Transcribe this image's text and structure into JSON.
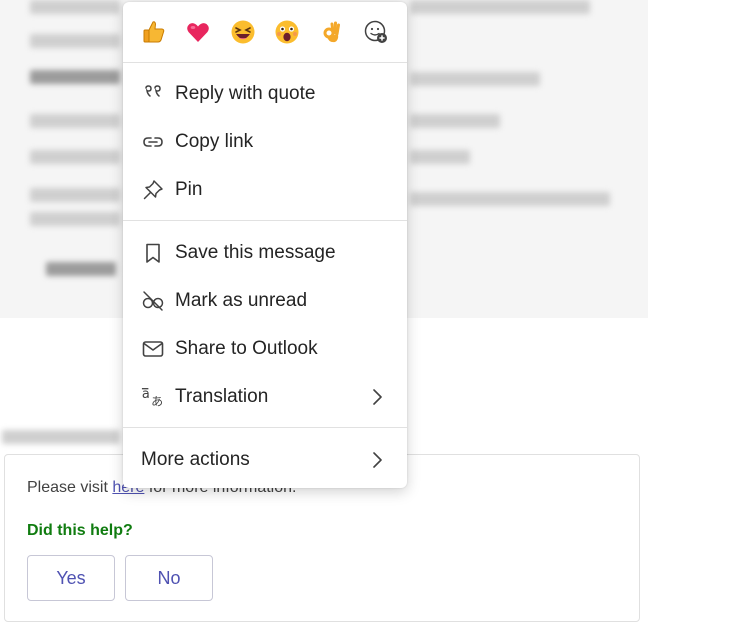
{
  "menu": {
    "reactions": [
      {
        "name": "like",
        "emoji": "👍"
      },
      {
        "name": "heart",
        "emoji": "❤️"
      },
      {
        "name": "laugh",
        "emoji": "😆"
      },
      {
        "name": "surprised",
        "emoji": "😮"
      },
      {
        "name": "ok",
        "emoji": "👌"
      },
      {
        "name": "add-reaction",
        "emoji": ""
      }
    ],
    "items": {
      "reply": "Reply with quote",
      "copy_link": "Copy link",
      "pin": "Pin",
      "save": "Save this message",
      "unread": "Mark as unread",
      "outlook": "Share to Outlook",
      "translation": "Translation",
      "more": "More actions"
    }
  },
  "card": {
    "text_prefix": "Please visit ",
    "link": "here",
    "text_suffix": " for more information.",
    "question": "Did this help?",
    "yes": "Yes",
    "no": "No"
  },
  "colors": {
    "accent": "#4f52b2",
    "question": "#107c10"
  }
}
